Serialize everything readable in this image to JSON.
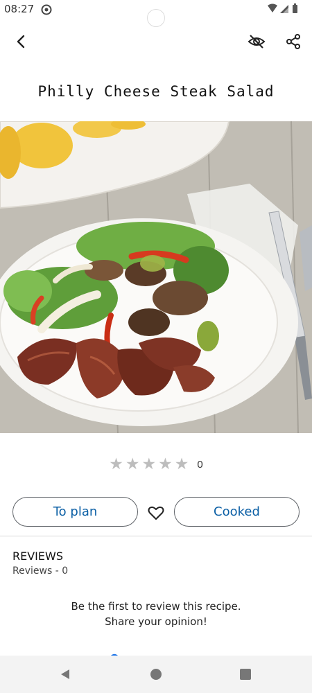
{
  "status_bar": {
    "time": "08:27"
  },
  "toolbar": {
    "back_icon": "back-arrow-icon",
    "hide_icon": "eye-off-icon",
    "share_icon": "share-icon"
  },
  "recipe": {
    "title": "Philly Cheese Steak Salad",
    "rating": {
      "stars": 5,
      "filled": 0,
      "count": "0"
    }
  },
  "actions": {
    "plan_label": "To plan",
    "cooked_label": "Cooked",
    "favorite_icon": "heart-outline-icon"
  },
  "reviews": {
    "heading": "REVIEWS",
    "count_label": "Reviews - 0",
    "empty_message": "Be the first to review this recipe. Share your opinion!"
  },
  "colors": {
    "accent": "#0b5fa5",
    "star_empty": "#bdbdbd",
    "divider": "#d6d6d6"
  }
}
